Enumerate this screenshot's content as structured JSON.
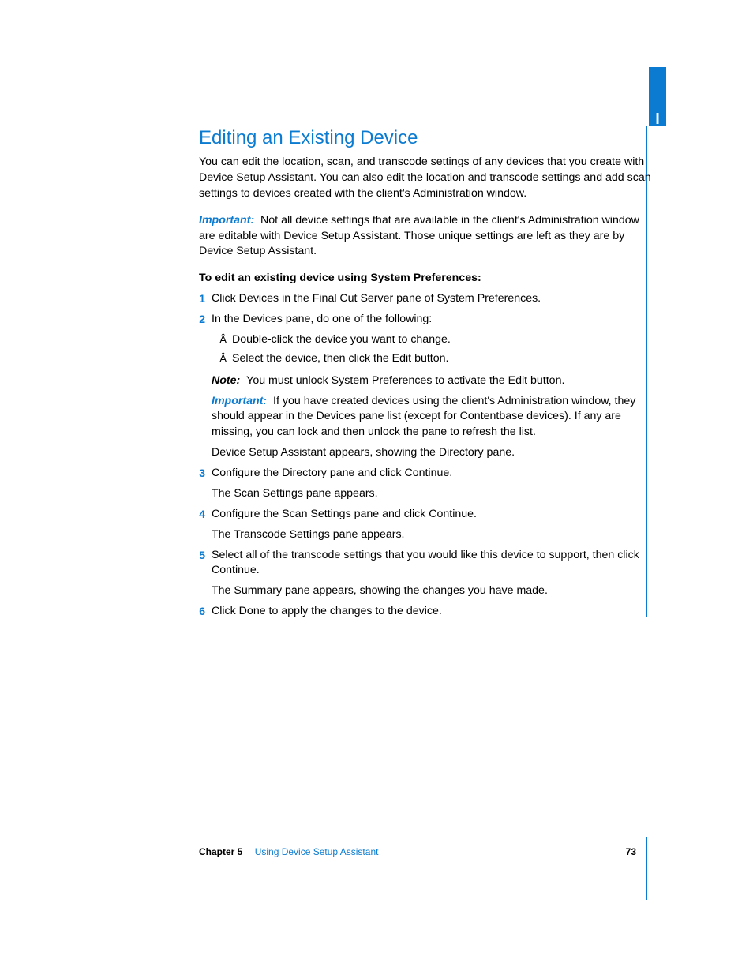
{
  "tab": {
    "label": "I"
  },
  "heading": "Editing an Existing Device",
  "intro": "You can edit the location, scan, and transcode settings of any devices that you create with Device Setup Assistant. You can also edit the location and transcode settings and add scan settings to devices created with the client's Administration window.",
  "intro_important": {
    "label": "Important:",
    "text": "Not all device settings that are available in the client's Administration window are editable with Device Setup Assistant. Those unique settings are left as they are by Device Setup Assistant."
  },
  "lead_in": "To edit an existing device using System Preferences:",
  "steps": [
    {
      "num": "1",
      "body": "Click Devices in the Final Cut Server pane of System Preferences."
    },
    {
      "num": "2",
      "body": "In the Devices pane, do one of the following:",
      "bullets": [
        "Double-click the device you want to change.",
        "Select the device, then click the Edit button."
      ],
      "note": {
        "label": "Note:",
        "text": "You must unlock System Preferences to activate the Edit button."
      },
      "important": {
        "label": "Important:",
        "text": "If you have created devices using the client's Administration window, they should appear in the Devices pane list (except for Contentbase devices). If any are missing, you can lock and then unlock the pane to refresh the list."
      },
      "follow": "Device Setup Assistant appears, showing the Directory pane."
    },
    {
      "num": "3",
      "body": "Configure the Directory pane and click Continue.",
      "follow": "The Scan Settings pane appears."
    },
    {
      "num": "4",
      "body": "Configure the Scan Settings pane and click Continue.",
      "follow": "The Transcode Settings pane appears."
    },
    {
      "num": "5",
      "body": "Select all of the transcode settings that you would like this device to support, then click Continue.",
      "follow": "The Summary pane appears, showing the changes you have made."
    },
    {
      "num": "6",
      "body": "Click Done to apply the changes to the device."
    }
  ],
  "footer": {
    "chapter_label": "Chapter 5",
    "chapter_title": "Using Device Setup Assistant",
    "page_num": "73"
  }
}
